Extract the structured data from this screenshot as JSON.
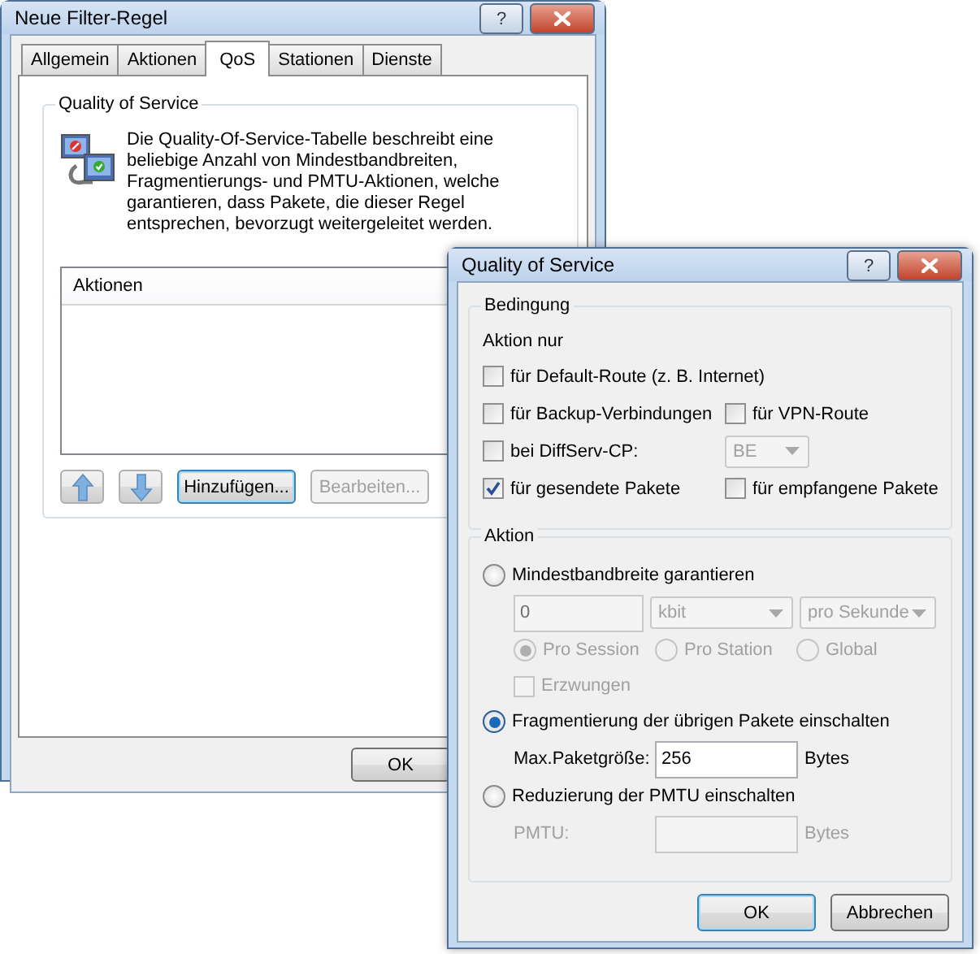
{
  "back_window": {
    "title": "Neue Filter-Regel",
    "help_button": "?",
    "tabs": [
      {
        "label": "Allgemein",
        "selected": false
      },
      {
        "label": "Aktionen",
        "selected": false
      },
      {
        "label": "QoS",
        "selected": true
      },
      {
        "label": "Stationen",
        "selected": false
      },
      {
        "label": "Dienste",
        "selected": false
      }
    ],
    "group_title": "Quality of Service",
    "description": "Die Quality-Of-Service-Tabelle beschreibt eine beliebige Anzahl von Mindestbandbreiten, Fragmentierungs- und PMTU-Aktionen, welche garantieren, dass Pakete, die dieser Regel entsprechen, bevorzugt weitergeleitet werden.",
    "list_columns": [
      "Aktionen"
    ],
    "buttons": [
      {
        "kind": "up",
        "disabled": false
      },
      {
        "kind": "down",
        "disabled": false
      },
      {
        "kind": "text",
        "label": "Hinzufügen...",
        "disabled": false,
        "focused": true
      },
      {
        "kind": "text",
        "label": "Bearbeiten...",
        "disabled": true,
        "focused": false
      }
    ],
    "ok_button": "OK"
  },
  "front_window": {
    "title": "Quality of Service",
    "help_button": "?",
    "condition": {
      "title": "Bedingung",
      "subtitle": "Aktion nur",
      "rows": [
        [
          {
            "kind": "checkbox",
            "label": "für Default-Route (z. B. Internet)",
            "checked": false
          }
        ],
        [
          {
            "kind": "checkbox",
            "label": "für Backup-Verbindungen",
            "checked": false
          },
          {
            "kind": "checkbox",
            "label": "für VPN-Route",
            "checked": false
          }
        ],
        [
          {
            "kind": "checkbox",
            "label": "bei DiffServ-CP:",
            "checked": false
          },
          {
            "kind": "dropdown",
            "value": "BE",
            "disabled": true
          }
        ],
        [
          {
            "kind": "checkbox",
            "label": "für gesendete Pakete",
            "checked": true
          },
          {
            "kind": "checkbox",
            "label": "für empfangene Pakete",
            "checked": false
          }
        ]
      ]
    },
    "action": {
      "title": "Aktion",
      "rows": [
        {
          "kind": "radio",
          "label": "Mindestbandbreite garantieren",
          "selected": false,
          "disabled": false
        },
        {
          "kind": "fields",
          "items": [
            {
              "kind": "input",
              "value": "0",
              "disabled": true
            },
            {
              "kind": "dropdown",
              "value": "kbit",
              "disabled": true
            },
            {
              "kind": "dropdown",
              "value": "pro Sekunde",
              "disabled": true
            }
          ]
        },
        {
          "kind": "radios",
          "items": [
            {
              "label": "Pro Session",
              "selected": true,
              "disabled": true
            },
            {
              "label": "Pro Station",
              "selected": false,
              "disabled": true
            },
            {
              "label": "Global",
              "selected": false,
              "disabled": true
            }
          ]
        },
        {
          "kind": "checkbox",
          "label": "Erzwungen",
          "checked": false,
          "disabled": true
        },
        {
          "kind": "radio",
          "label": "Fragmentierung der übrigen Pakete einschalten",
          "selected": true,
          "disabled": false
        },
        {
          "kind": "fields",
          "items": [
            {
              "kind": "label",
              "text": "Max.Paketgröße:",
              "disabled": false
            },
            {
              "kind": "input",
              "value": "256",
              "disabled": false
            },
            {
              "kind": "label",
              "text": "Bytes",
              "disabled": false
            }
          ]
        },
        {
          "kind": "radio",
          "label": "Reduzierung der PMTU einschalten",
          "selected": false,
          "disabled": false
        },
        {
          "kind": "fields",
          "items": [
            {
              "kind": "label",
              "text": "PMTU:",
              "disabled": true
            },
            {
              "kind": "input",
              "disabled": true
            },
            {
              "kind": "label",
              "text": "Bytes",
              "disabled": true
            }
          ]
        }
      ]
    },
    "buttons": [
      {
        "label": "OK",
        "default": true
      },
      {
        "label": "Abbrechen",
        "default": false
      }
    ]
  }
}
